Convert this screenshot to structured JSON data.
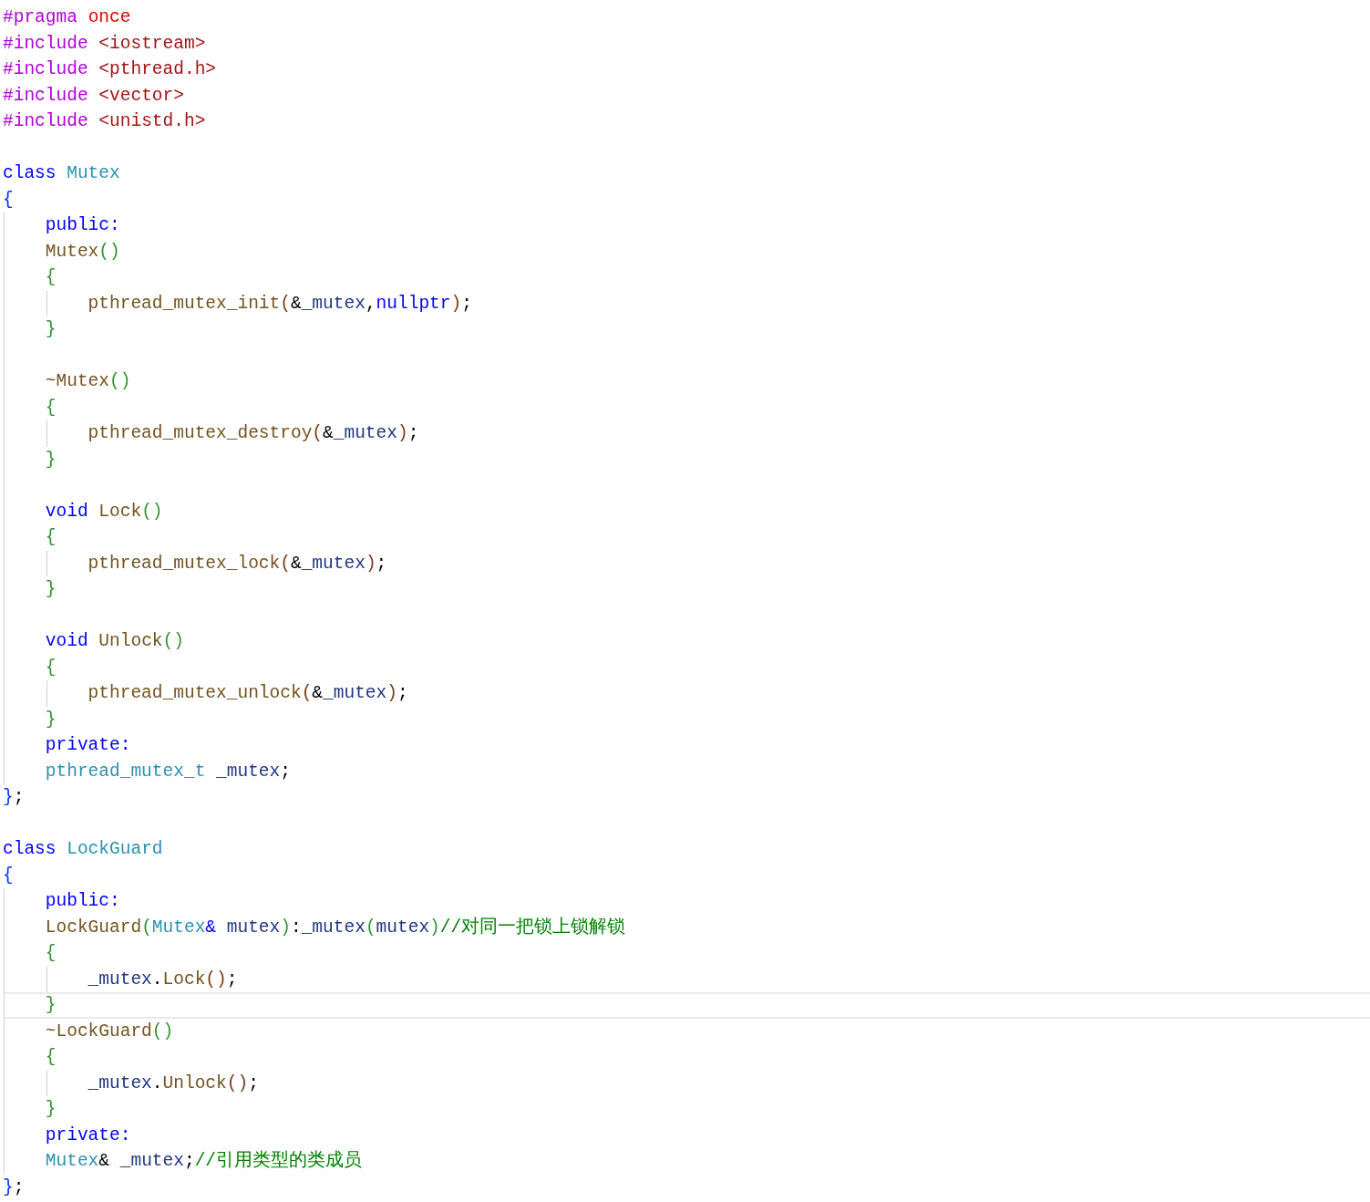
{
  "editor": {
    "lines": [
      {
        "kind": "code",
        "current": false,
        "tokens": [
          {
            "kind": "pre",
            "text": "#pragma "
          },
          {
            "kind": "lit",
            "text": "once"
          }
        ]
      },
      {
        "kind": "code",
        "current": false,
        "tokens": [
          {
            "kind": "pre",
            "text": "#include "
          },
          {
            "kind": "str",
            "text": "<iostream>"
          }
        ]
      },
      {
        "kind": "code",
        "current": false,
        "tokens": [
          {
            "kind": "pre",
            "text": "#include "
          },
          {
            "kind": "str",
            "text": "<pthread.h>"
          }
        ]
      },
      {
        "kind": "code",
        "current": false,
        "tokens": [
          {
            "kind": "pre",
            "text": "#include "
          },
          {
            "kind": "str",
            "text": "<vector>"
          }
        ]
      },
      {
        "kind": "code",
        "current": false,
        "tokens": [
          {
            "kind": "pre",
            "text": "#include "
          },
          {
            "kind": "str",
            "text": "<unistd.h>"
          }
        ]
      },
      {
        "kind": "blank",
        "current": false
      },
      {
        "kind": "code",
        "current": false,
        "tokens": [
          {
            "kind": "kw",
            "text": "class "
          },
          {
            "kind": "type",
            "text": "Mutex"
          }
        ]
      },
      {
        "kind": "code",
        "current": false,
        "tokens": [
          {
            "kind": "b1",
            "text": "{"
          }
        ]
      },
      {
        "kind": "code",
        "current": false,
        "tokens": [
          {
            "kind": "kw",
            "text": "    public:"
          }
        ]
      },
      {
        "kind": "code",
        "current": false,
        "tokens": [
          {
            "kind": "fn",
            "text": "    Mutex"
          },
          {
            "kind": "b2",
            "text": "()"
          }
        ]
      },
      {
        "kind": "code",
        "current": false,
        "tokens": [
          {
            "kind": "b2",
            "text": "    {"
          }
        ]
      },
      {
        "kind": "code",
        "current": false,
        "tokens": [
          {
            "kind": "fn",
            "text": "        pthread_mutex_init"
          },
          {
            "kind": "b3",
            "text": "("
          },
          {
            "kind": "plain",
            "text": "&"
          },
          {
            "kind": "var",
            "text": "_mutex"
          },
          {
            "kind": "plain",
            "text": ","
          },
          {
            "kind": "kw",
            "text": "nullptr"
          },
          {
            "kind": "b3",
            "text": ")"
          },
          {
            "kind": "plain",
            "text": ";"
          }
        ]
      },
      {
        "kind": "code",
        "current": false,
        "tokens": [
          {
            "kind": "b2",
            "text": "    }"
          }
        ]
      },
      {
        "kind": "blank",
        "current": false
      },
      {
        "kind": "code",
        "current": false,
        "tokens": [
          {
            "kind": "fn",
            "text": "    ~Mutex"
          },
          {
            "kind": "b2",
            "text": "()"
          }
        ]
      },
      {
        "kind": "code",
        "current": false,
        "tokens": [
          {
            "kind": "b2",
            "text": "    {"
          }
        ]
      },
      {
        "kind": "code",
        "current": false,
        "tokens": [
          {
            "kind": "fn",
            "text": "        pthread_mutex_destroy"
          },
          {
            "kind": "b3",
            "text": "("
          },
          {
            "kind": "plain",
            "text": "&"
          },
          {
            "kind": "var",
            "text": "_mutex"
          },
          {
            "kind": "b3",
            "text": ")"
          },
          {
            "kind": "plain",
            "text": ";"
          }
        ]
      },
      {
        "kind": "code",
        "current": false,
        "tokens": [
          {
            "kind": "b2",
            "text": "    }"
          }
        ]
      },
      {
        "kind": "blank",
        "current": false
      },
      {
        "kind": "code",
        "current": false,
        "tokens": [
          {
            "kind": "kw",
            "text": "    void "
          },
          {
            "kind": "fn",
            "text": "Lock"
          },
          {
            "kind": "b2",
            "text": "()"
          }
        ]
      },
      {
        "kind": "code",
        "current": false,
        "tokens": [
          {
            "kind": "b2",
            "text": "    {"
          }
        ]
      },
      {
        "kind": "code",
        "current": false,
        "tokens": [
          {
            "kind": "fn",
            "text": "        pthread_mutex_lock"
          },
          {
            "kind": "b3",
            "text": "("
          },
          {
            "kind": "plain",
            "text": "&"
          },
          {
            "kind": "var",
            "text": "_mutex"
          },
          {
            "kind": "b3",
            "text": ")"
          },
          {
            "kind": "plain",
            "text": ";"
          }
        ]
      },
      {
        "kind": "code",
        "current": false,
        "tokens": [
          {
            "kind": "b2",
            "text": "    }"
          }
        ]
      },
      {
        "kind": "blank",
        "current": false
      },
      {
        "kind": "code",
        "current": false,
        "tokens": [
          {
            "kind": "kw",
            "text": "    void "
          },
          {
            "kind": "fn",
            "text": "Unlock"
          },
          {
            "kind": "b2",
            "text": "()"
          }
        ]
      },
      {
        "kind": "code",
        "current": false,
        "tokens": [
          {
            "kind": "b2",
            "text": "    {"
          }
        ]
      },
      {
        "kind": "code",
        "current": false,
        "tokens": [
          {
            "kind": "fn",
            "text": "        pthread_mutex_unlock"
          },
          {
            "kind": "b3",
            "text": "("
          },
          {
            "kind": "plain",
            "text": "&"
          },
          {
            "kind": "var",
            "text": "_mutex"
          },
          {
            "kind": "b3",
            "text": ")"
          },
          {
            "kind": "plain",
            "text": ";"
          }
        ]
      },
      {
        "kind": "code",
        "current": false,
        "tokens": [
          {
            "kind": "b2",
            "text": "    }"
          }
        ]
      },
      {
        "kind": "code",
        "current": false,
        "tokens": [
          {
            "kind": "kw",
            "text": "    private:"
          }
        ]
      },
      {
        "kind": "code",
        "current": false,
        "tokens": [
          {
            "kind": "type",
            "text": "    pthread_mutex_t"
          },
          {
            "kind": "var",
            "text": " _mutex"
          },
          {
            "kind": "plain",
            "text": ";"
          }
        ]
      },
      {
        "kind": "code",
        "current": false,
        "tokens": [
          {
            "kind": "b1",
            "text": "}"
          },
          {
            "kind": "plain",
            "text": ";"
          }
        ]
      },
      {
        "kind": "blank",
        "current": false
      },
      {
        "kind": "code",
        "current": false,
        "tokens": [
          {
            "kind": "kw",
            "text": "class "
          },
          {
            "kind": "type",
            "text": "LockGuard"
          }
        ]
      },
      {
        "kind": "code",
        "current": false,
        "tokens": [
          {
            "kind": "b1",
            "text": "{"
          }
        ]
      },
      {
        "kind": "code",
        "current": false,
        "tokens": [
          {
            "kind": "kw",
            "text": "    public:"
          }
        ]
      },
      {
        "kind": "code",
        "current": false,
        "tokens": [
          {
            "kind": "fn",
            "text": "    LockGuard"
          },
          {
            "kind": "b2",
            "text": "("
          },
          {
            "kind": "type",
            "text": "Mutex"
          },
          {
            "kind": "kw",
            "text": "&"
          },
          {
            "kind": "var",
            "text": " mutex"
          },
          {
            "kind": "b2",
            "text": ")"
          },
          {
            "kind": "plain",
            "text": ":"
          },
          {
            "kind": "var",
            "text": "_mutex"
          },
          {
            "kind": "b2",
            "text": "("
          },
          {
            "kind": "var",
            "text": "mutex"
          },
          {
            "kind": "b2",
            "text": ")"
          },
          {
            "kind": "comment",
            "text": "//对同一把锁上锁解锁"
          }
        ]
      },
      {
        "kind": "code",
        "current": false,
        "tokens": [
          {
            "kind": "b2",
            "text": "    {"
          }
        ]
      },
      {
        "kind": "code",
        "current": false,
        "tokens": [
          {
            "kind": "var",
            "text": "        _mutex"
          },
          {
            "kind": "plain",
            "text": "."
          },
          {
            "kind": "fn",
            "text": "Lock"
          },
          {
            "kind": "b3",
            "text": "()"
          },
          {
            "kind": "plain",
            "text": ";"
          }
        ]
      },
      {
        "kind": "code",
        "current": true,
        "tokens": [
          {
            "kind": "b2",
            "text": "    }"
          }
        ]
      },
      {
        "kind": "code",
        "current": false,
        "tokens": [
          {
            "kind": "fn",
            "text": "    ~LockGuard"
          },
          {
            "kind": "b2",
            "text": "()"
          }
        ]
      },
      {
        "kind": "code",
        "current": false,
        "tokens": [
          {
            "kind": "b2",
            "text": "    {"
          }
        ]
      },
      {
        "kind": "code",
        "current": false,
        "tokens": [
          {
            "kind": "var",
            "text": "        _mutex"
          },
          {
            "kind": "plain",
            "text": "."
          },
          {
            "kind": "fn",
            "text": "Unlock"
          },
          {
            "kind": "b3",
            "text": "()"
          },
          {
            "kind": "plain",
            "text": ";"
          }
        ]
      },
      {
        "kind": "code",
        "current": false,
        "tokens": [
          {
            "kind": "b2",
            "text": "    }"
          }
        ]
      },
      {
        "kind": "code",
        "current": false,
        "tokens": [
          {
            "kind": "kw",
            "text": "    private:"
          }
        ]
      },
      {
        "kind": "code",
        "current": false,
        "tokens": [
          {
            "kind": "type",
            "text": "    Mutex"
          },
          {
            "kind": "plain",
            "text": "& "
          },
          {
            "kind": "var",
            "text": "_mutex"
          },
          {
            "kind": "plain",
            "text": ";"
          },
          {
            "kind": "comment",
            "text": "//引用类型的类成员"
          }
        ]
      },
      {
        "kind": "code",
        "current": false,
        "tokens": [
          {
            "kind": "b1",
            "text": "}"
          },
          {
            "kind": "plain",
            "text": ";"
          }
        ]
      }
    ]
  }
}
